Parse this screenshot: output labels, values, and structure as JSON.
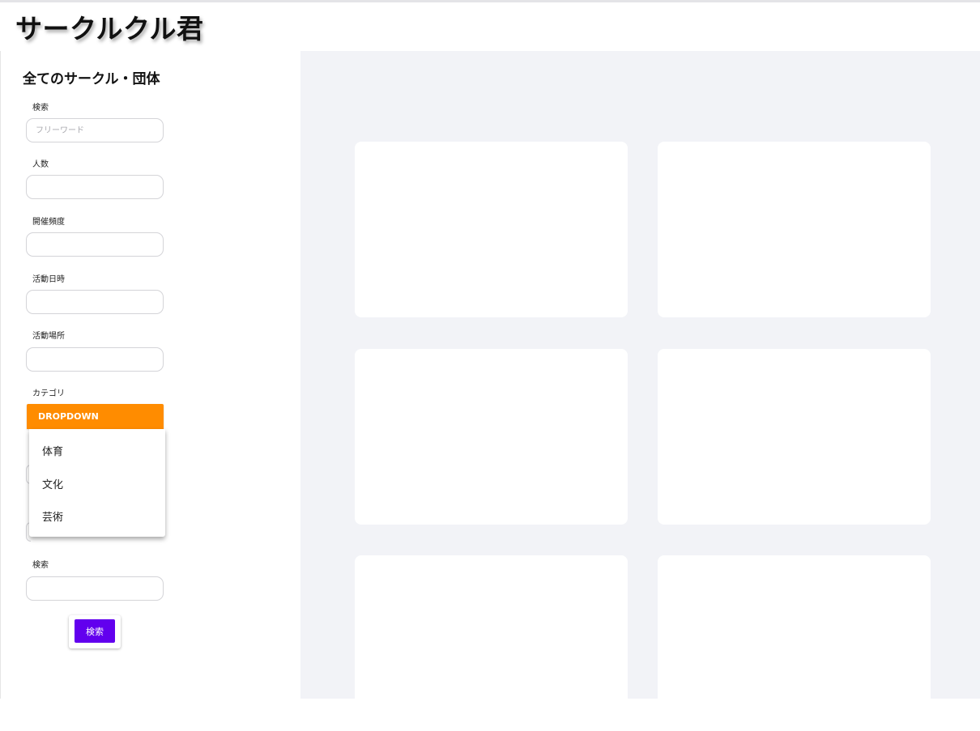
{
  "app": {
    "title": "サークルクル君"
  },
  "sidebar": {
    "heading": "全てのサークル・団体",
    "fields": {
      "freeword": {
        "label": "検索",
        "placeholder": "フリーワード",
        "value": ""
      },
      "members": {
        "label": "人数",
        "value": ""
      },
      "frequency": {
        "label": "開催頻度",
        "value": ""
      },
      "schedule": {
        "label": "活動日時",
        "value": ""
      },
      "place": {
        "label": "活動場所",
        "value": ""
      },
      "category": {
        "label": "カテゴリ",
        "dropdown_label": "DROPDOWN"
      },
      "search2": {
        "label": "検索",
        "value": ""
      }
    },
    "category_options": [
      "体育",
      "文化",
      "芸術"
    ],
    "search_button": "検索"
  },
  "main": {
    "cards": [
      "",
      "",
      "",
      "",
      "",
      ""
    ]
  },
  "colors": {
    "dropdown": "#ff8c00",
    "primary_button": "#6200ee",
    "main_bg": "#f2f3f7"
  }
}
